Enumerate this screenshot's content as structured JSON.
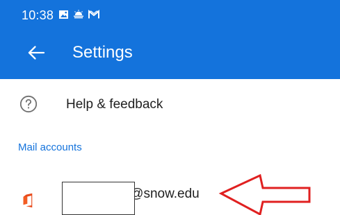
{
  "status_bar": {
    "time": "10:38",
    "icons": [
      "picture-icon",
      "weather-icon",
      "mail-notification-icon"
    ]
  },
  "header": {
    "back_icon": "arrow-left-icon",
    "title": "Settings"
  },
  "menu": {
    "help_icon": "help-circle-icon",
    "help_label": "Help & feedback"
  },
  "mail_accounts": {
    "header": "Mail accounts",
    "accounts": [
      {
        "icon": "office-icon",
        "email_visible_part": "rry@snow.edu",
        "redacted": true
      }
    ]
  },
  "annotation": {
    "arrow_icon": "red-outline-arrow"
  },
  "colors": {
    "appbar": "#1473dc",
    "accent": "#1473dc",
    "office_red": "#e84a1b",
    "annotation_red": "#e02020"
  }
}
